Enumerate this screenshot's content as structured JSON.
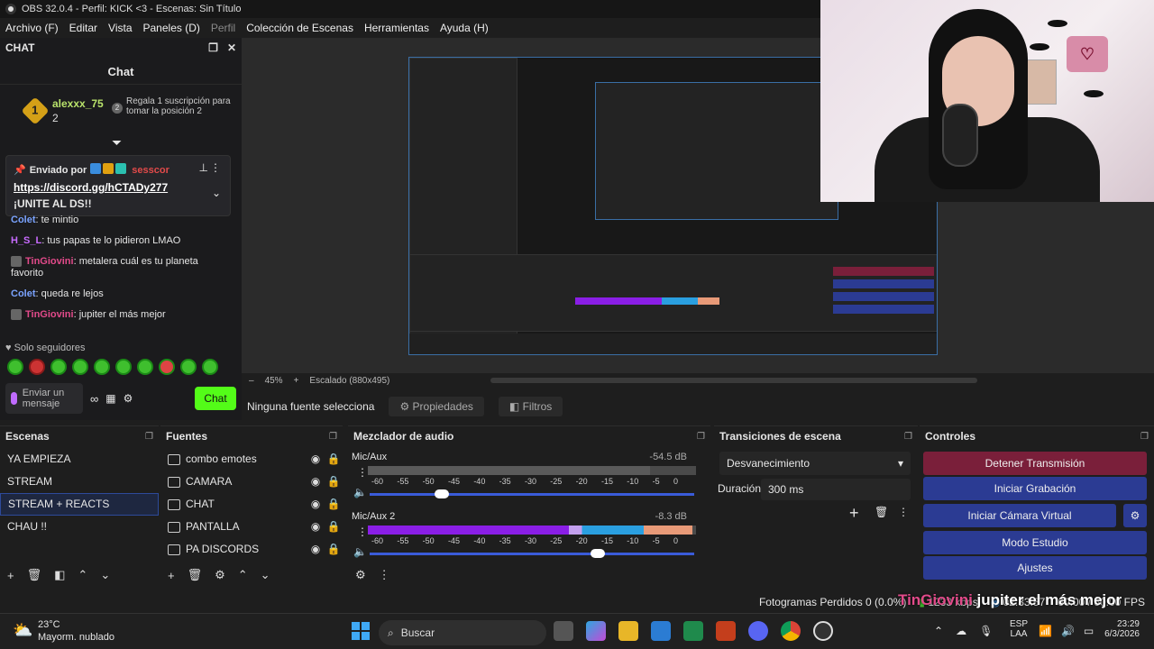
{
  "app": {
    "title": "OBS 32.0.4 - Perfil: KICK <3 - Escenas: Sin Título",
    "menu": [
      "Archivo (F)",
      "Editar",
      "Vista",
      "Paneles (D)",
      "Perfil",
      "Colección de Escenas",
      "Herramientas",
      "Ayuda (H)"
    ]
  },
  "chat_dock": {
    "title": "CHAT",
    "header": "Chat",
    "leader": {
      "rank": "1",
      "name": "alexxx_75",
      "count": "2",
      "gift_rank": "2",
      "gift_text": "Regala 1 suscripción para tomar la posición 2"
    },
    "pinned": {
      "label": "Enviado por",
      "user": "sesscor",
      "link": "https://discord.gg/hCTADy277",
      "message": "¡UNITE AL DS!!"
    },
    "messages": [
      {
        "user": "Colet",
        "color": "#7aa3ff",
        "text": "te mintio"
      },
      {
        "user": "H_S_L",
        "color": "#c86bff",
        "text": "tus papas te lo pidieron LMAO"
      },
      {
        "user": "TinGiovini",
        "color": "#e24a8a",
        "text": "metalera cuál es tu planeta favorito"
      },
      {
        "user": "Colet",
        "color": "#7aa3ff",
        "text": "queda re lejos"
      },
      {
        "user": "TinGiovini",
        "color": "#e24a8a",
        "text": "jupiter el más mejor"
      }
    ],
    "followers_only": "Solo seguidores",
    "send_placeholder": "Enviar un mensaje",
    "chat_button": "Chat"
  },
  "preview": {
    "zoom": "45%",
    "scaling": "Escalado (880x495)",
    "no_source": "Ninguna fuente selecciona",
    "properties": "Propiedades",
    "filters": "Filtros"
  },
  "scenes": {
    "title": "Escenas",
    "items": [
      "YA EMPIEZA",
      "STREAM",
      "STREAM + REACTS",
      "CHAU !!"
    ],
    "selected_index": 2
  },
  "sources": {
    "title": "Fuentes",
    "items": [
      "combo emotes",
      "CAMARA",
      "CHAT",
      "PANTALLA",
      "PA DISCORDS"
    ]
  },
  "mixer": {
    "title": "Mezclador de audio",
    "tracks": [
      {
        "name": "Mic/Aux",
        "db": "-54.5 dB",
        "level": 0.86,
        "volume": 0.2
      },
      {
        "name": "Mic/Aux 2",
        "db": "-8.3 dB",
        "level": 0.99,
        "volume": 0.68
      }
    ],
    "scale": [
      "-60",
      "-55",
      "-50",
      "-45",
      "-40",
      "-35",
      "-30",
      "-25",
      "-20",
      "-15",
      "-10",
      "-5",
      "0"
    ]
  },
  "transitions": {
    "title": "Transiciones de escena",
    "selected": "Desvanecimiento",
    "duration_label": "Duración",
    "duration_value": "300 ms"
  },
  "controls": {
    "title": "Controles",
    "buttons": [
      "Detener Transmisión",
      "Iniciar Grabación",
      "Iniciar Cámara Virtual",
      "Modo Estudio",
      "Ajustes"
    ]
  },
  "status": {
    "dropped": "Fotogramas Perdidos 0 (0.0%)",
    "bitrate": "1233 kbps",
    "time": "02:33:57",
    "fps": "60.00 / 60.00 FPS"
  },
  "overlay": {
    "user": "TinGiovini",
    "text": "jupiter el más mejor"
  },
  "taskbar": {
    "weather_temp": "23°C",
    "weather_desc": "Mayorm. nublado",
    "search": "Buscar",
    "lang1": "ESP",
    "lang2": "LAA",
    "clock_time": "23:29",
    "clock_date": "6/3/2026"
  },
  "colors": {
    "kick_green": "#53fc18",
    "stop_red": "#7a1f3a",
    "control_blue": "#2b3b93"
  }
}
